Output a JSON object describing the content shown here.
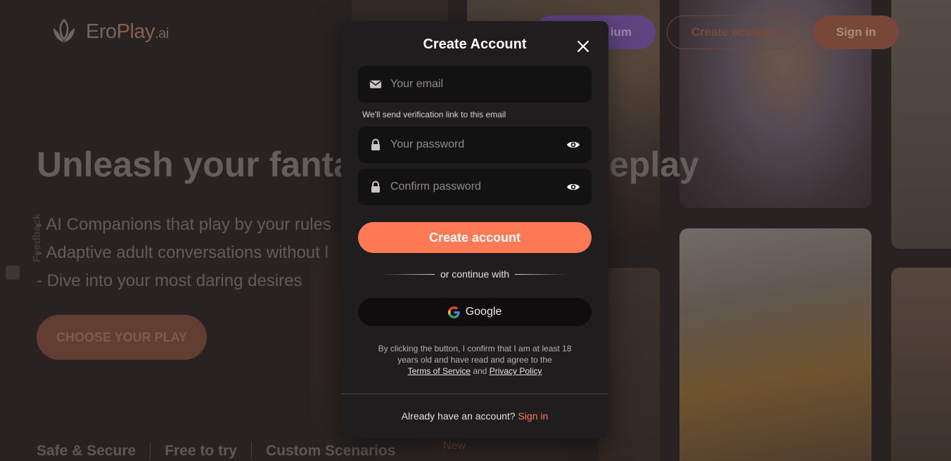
{
  "background": {
    "logo": {
      "brand_part1": "Ero",
      "brand_part2": "Play",
      "brand_suffix": ".ai"
    },
    "header": {
      "premium_label": "ium",
      "create_account_label": "Create account",
      "sign_in_label": "Sign in"
    },
    "hero": {
      "title_left": "Unleash your fanta",
      "title_right": "eplay",
      "bullets": [
        "- AI Companions that play by your rules",
        "- Adaptive adult conversations without l",
        "- Dive into your most daring desires"
      ],
      "cta_label": "CHOOSE YOUR PLAY"
    },
    "features": [
      "Safe & Secure",
      "Free to try",
      "Custom Scenarios"
    ],
    "new_badge": "New",
    "feedback_label": "Feedback"
  },
  "modal": {
    "title": "Create Account",
    "email_placeholder": "Your email",
    "email_hint": "We'll send verification link to this email",
    "password_placeholder": "Your password",
    "confirm_placeholder": "Confirm password",
    "create_button": "Create account",
    "divider_text": "or continue with",
    "google_button": "Google",
    "terms_line1": "By clicking the button, I confirm that I am at least 18 years old and have read and agree to the",
    "terms_link": "Terms of Service",
    "terms_and": "and",
    "privacy_link": "Privacy Policy",
    "footer_prompt": "Already have an account?",
    "footer_link": "Sign in"
  },
  "colors": {
    "accent": "#ff7a54",
    "modal_bg": "#1f1d1d",
    "field_bg": "#131212"
  }
}
